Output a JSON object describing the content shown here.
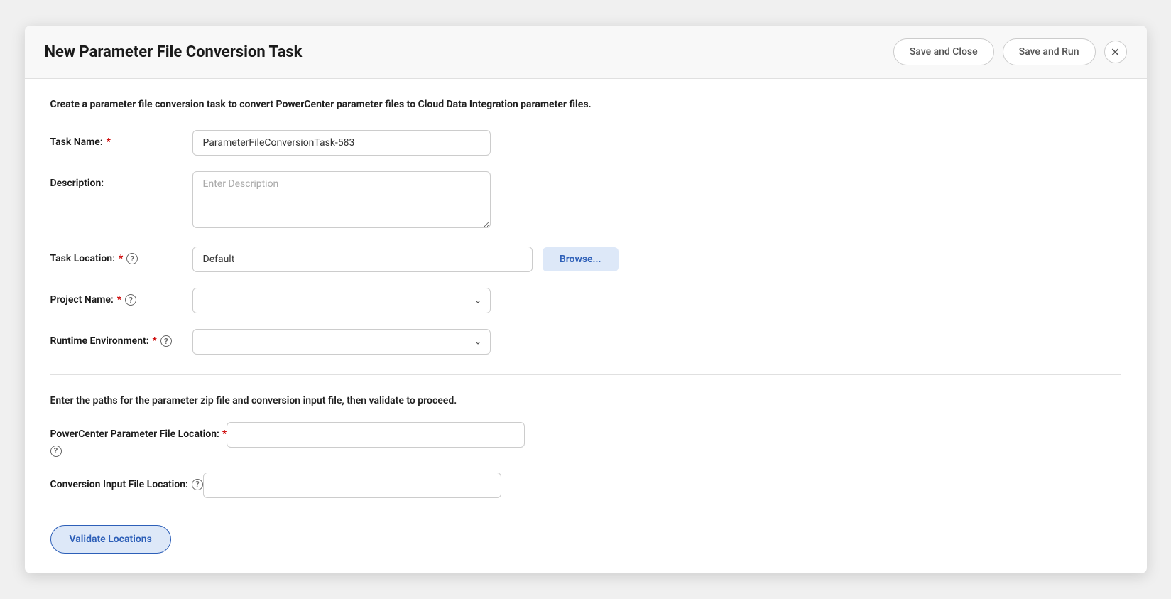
{
  "header": {
    "title": "New Parameter File Conversion Task",
    "save_close_label": "Save and Close",
    "save_run_label": "Save and Run",
    "close_icon": "✕"
  },
  "section1": {
    "description": "Create a parameter file conversion task to convert PowerCenter parameter files to Cloud Data Integration parameter files.",
    "task_name_label": "Task Name:",
    "task_name_value": "ParameterFileConversionTask-583",
    "task_name_placeholder": "",
    "description_label": "Description:",
    "description_placeholder": "Enter Description",
    "task_location_label": "Task Location:",
    "task_location_value": "Default",
    "browse_label": "Browse...",
    "project_name_label": "Project Name:",
    "project_name_placeholder": "",
    "runtime_env_label": "Runtime Environment:",
    "runtime_env_placeholder": ""
  },
  "section2": {
    "description": "Enter the paths for the parameter zip file and conversion input file, then validate to proceed.",
    "pc_file_location_label": "PowerCenter Parameter File Location:",
    "pc_file_location_placeholder": "",
    "conversion_input_label": "Conversion Input File Location:",
    "conversion_input_placeholder": "",
    "validate_label": "Validate Locations"
  }
}
